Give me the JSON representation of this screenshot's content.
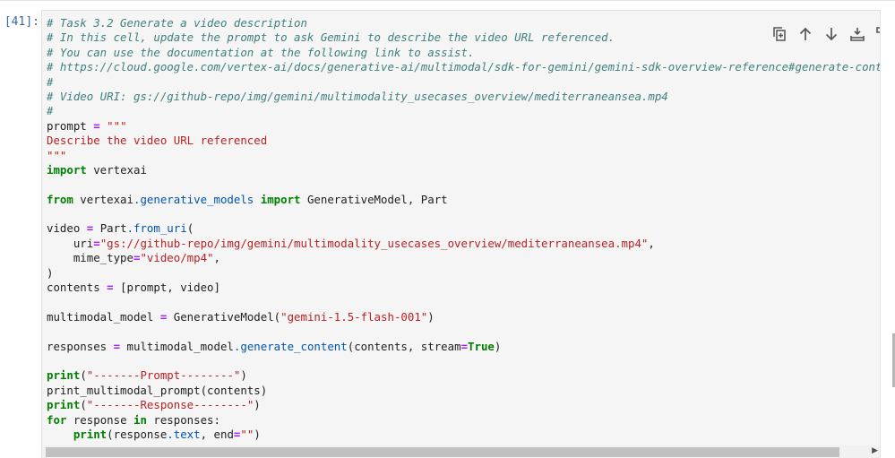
{
  "cell": {
    "prompt_label": "[41]:",
    "code_lines": [
      [
        {
          "t": "# Task 3.2 Generate a video description",
          "c": "com"
        }
      ],
      [
        {
          "t": "# In this cell, update the prompt to ask Gemini to describe the video URL referenced.",
          "c": "com"
        }
      ],
      [
        {
          "t": "# You can use the documentation at the following link to assist.",
          "c": "com"
        }
      ],
      [
        {
          "t": "# https://cloud.google.com/vertex-ai/docs/generative-ai/multimodal/sdk-for-gemini/gemini-sdk-overview-reference#generate-content-from-v",
          "c": "com"
        }
      ],
      [
        {
          "t": "#",
          "c": "com"
        }
      ],
      [
        {
          "t": "# Video URI: gs://github-repo/img/gemini/multimodality_usecases_overview/mediterraneansea.mp4",
          "c": "com"
        }
      ],
      [
        {
          "t": "#",
          "c": "com"
        }
      ],
      [
        {
          "t": "prompt "
        },
        {
          "t": "=",
          "c": "op"
        },
        {
          "t": " "
        },
        {
          "t": "\"\"\"",
          "c": "str"
        }
      ],
      [
        {
          "t": "Describe the video URL referenced",
          "c": "str"
        }
      ],
      [
        {
          "t": "\"\"\"",
          "c": "str"
        }
      ],
      [
        {
          "t": "import",
          "c": "kw"
        },
        {
          "t": " vertexai"
        }
      ],
      [],
      [
        {
          "t": "from",
          "c": "kw"
        },
        {
          "t": " vertexai"
        },
        {
          "t": ".generative_models",
          "c": "fn"
        },
        {
          "t": " "
        },
        {
          "t": "import",
          "c": "kw"
        },
        {
          "t": " GenerativeModel, Part"
        }
      ],
      [],
      [
        {
          "t": "video "
        },
        {
          "t": "=",
          "c": "op"
        },
        {
          "t": " Part"
        },
        {
          "t": ".from_uri",
          "c": "fn"
        },
        {
          "t": "("
        }
      ],
      [
        {
          "t": "    uri"
        },
        {
          "t": "=",
          "c": "op"
        },
        {
          "t": "\"gs://github-repo/img/gemini/multimodality_usecases_overview/mediterraneansea.mp4\"",
          "c": "str"
        },
        {
          "t": ","
        }
      ],
      [
        {
          "t": "    mime_type"
        },
        {
          "t": "=",
          "c": "op"
        },
        {
          "t": "\"video/mp4\"",
          "c": "str"
        },
        {
          "t": ","
        }
      ],
      [
        {
          "t": ")"
        }
      ],
      [
        {
          "t": "contents "
        },
        {
          "t": "=",
          "c": "op"
        },
        {
          "t": " [prompt, video]"
        }
      ],
      [],
      [
        {
          "t": "multimodal_model "
        },
        {
          "t": "=",
          "c": "op"
        },
        {
          "t": " GenerativeModel("
        },
        {
          "t": "\"gemini-1.5-flash-001\"",
          "c": "str"
        },
        {
          "t": ")"
        }
      ],
      [],
      [
        {
          "t": "responses "
        },
        {
          "t": "=",
          "c": "op"
        },
        {
          "t": " multimodal_model"
        },
        {
          "t": ".generate_content",
          "c": "fn"
        },
        {
          "t": "(contents, stream"
        },
        {
          "t": "=",
          "c": "op"
        },
        {
          "t": "True",
          "c": "kw"
        },
        {
          "t": ")"
        }
      ],
      [],
      [
        {
          "t": "print",
          "c": "kw"
        },
        {
          "t": "("
        },
        {
          "t": "\"-------Prompt--------\"",
          "c": "str"
        },
        {
          "t": ")"
        }
      ],
      [
        {
          "t": "print_multimodal_prompt(contents)"
        }
      ],
      [
        {
          "t": "print",
          "c": "kw"
        },
        {
          "t": "("
        },
        {
          "t": "\"-------Response--------\"",
          "c": "str"
        },
        {
          "t": ")"
        }
      ],
      [
        {
          "t": "for",
          "c": "kw"
        },
        {
          "t": " response "
        },
        {
          "t": "in",
          "c": "kw"
        },
        {
          "t": " responses:"
        }
      ],
      [
        {
          "t": "    "
        },
        {
          "t": "print",
          "c": "kw"
        },
        {
          "t": "(response"
        },
        {
          "t": ".text",
          "c": "fn"
        },
        {
          "t": ", end"
        },
        {
          "t": "=",
          "c": "op"
        },
        {
          "t": "\"\"",
          "c": "str"
        },
        {
          "t": ")"
        }
      ]
    ]
  },
  "toolbar": {
    "buttons": [
      {
        "name": "duplicate-cell-button",
        "icon": "duplicate-icon"
      },
      {
        "name": "move-up-button",
        "icon": "arrow-up-icon"
      },
      {
        "name": "move-down-button",
        "icon": "arrow-down-icon"
      },
      {
        "name": "insert-above-button",
        "icon": "insert-above-icon"
      },
      {
        "name": "insert-below-button",
        "icon": "insert-below-icon"
      },
      {
        "name": "delete-cell-button",
        "icon": "trash-icon"
      }
    ]
  },
  "colors": {
    "comment": "#408080",
    "keyword": "#008000",
    "string": "#ba2121",
    "operator": "#aa22ff",
    "attribute": "#0055aa",
    "prompt": "#3b68a8"
  }
}
